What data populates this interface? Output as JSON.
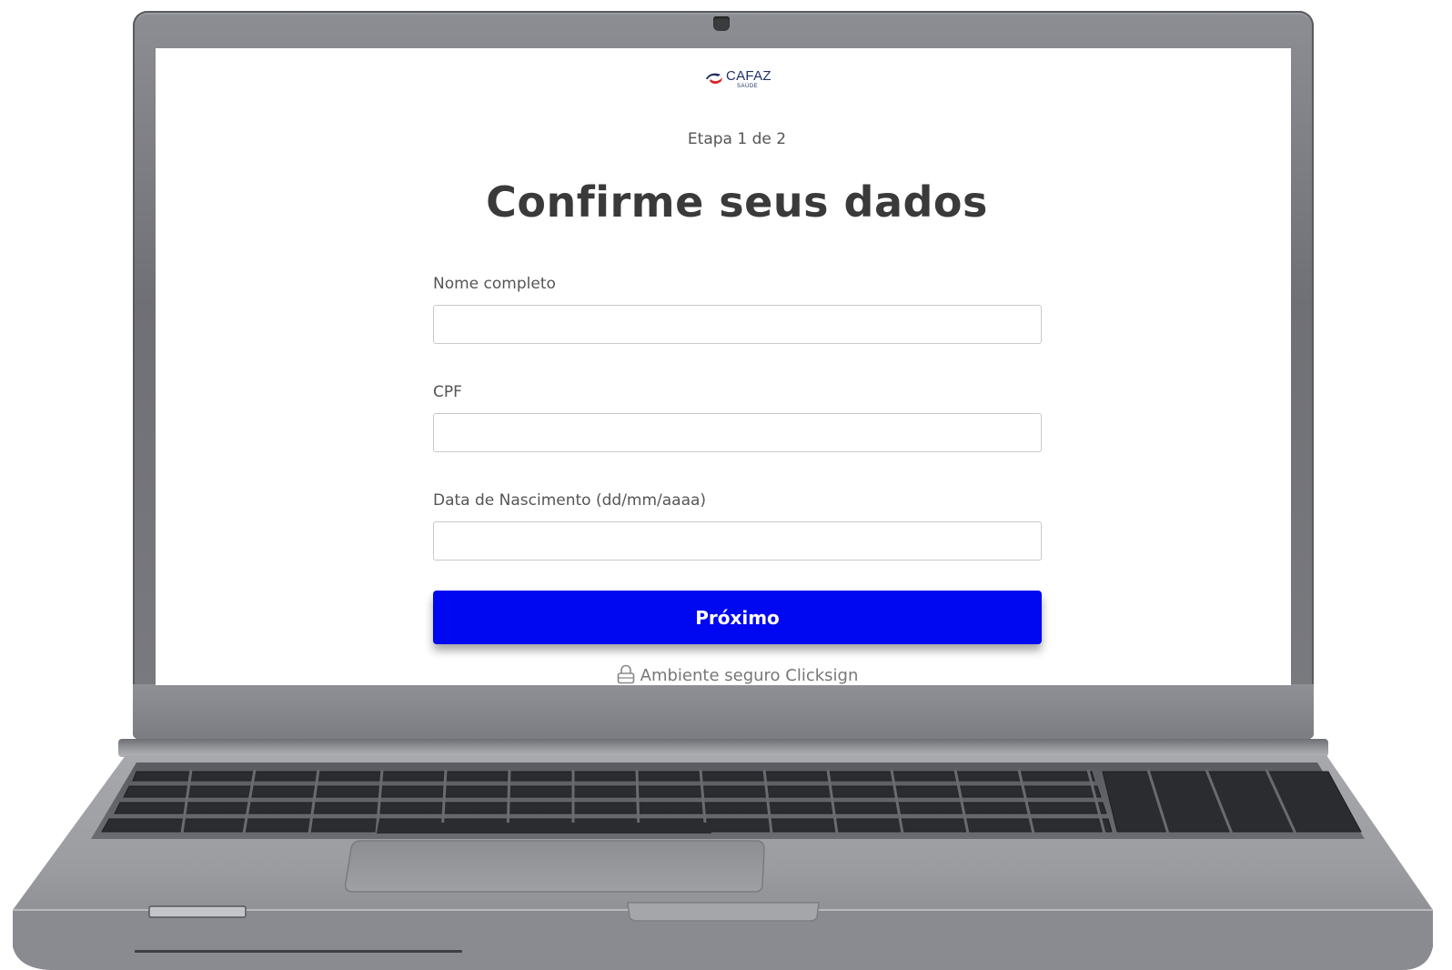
{
  "brand": {
    "name": "CAFAZ",
    "subtitle": "SAÚDE",
    "accent": "#0008f2",
    "logo_colors": [
      "#d6242a",
      "#1f2f66"
    ]
  },
  "step": {
    "text": "Etapa 1 de 2"
  },
  "title": "Confirme seus dados",
  "form": {
    "fields": [
      {
        "label": "Nome completo",
        "value": "",
        "placeholder": ""
      },
      {
        "label": "CPF",
        "value": "",
        "placeholder": ""
      },
      {
        "label": "Data de Nascimento (dd/mm/aaaa)",
        "value": "",
        "placeholder": ""
      }
    ],
    "submit_label": "Próximo"
  },
  "footer": {
    "secure_text": "Ambiente seguro Clicksign",
    "icon": "lock-icon"
  }
}
